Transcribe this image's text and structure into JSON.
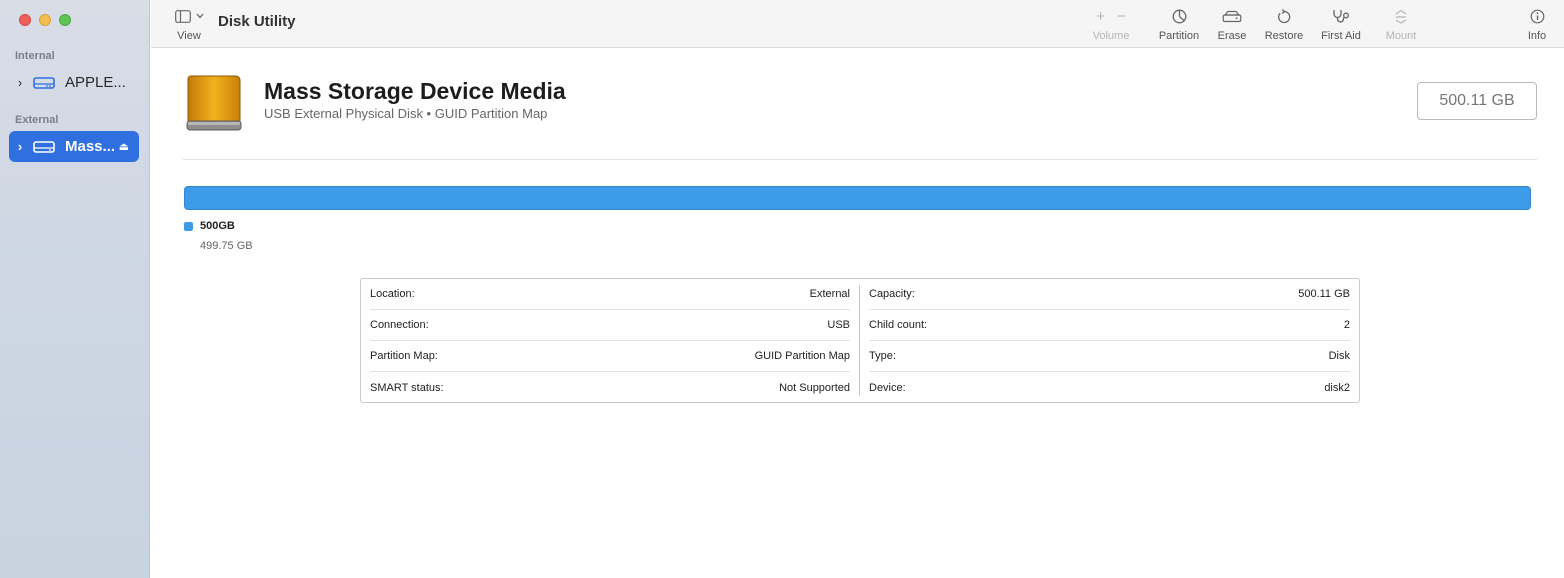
{
  "window": {
    "title": "Disk Utility"
  },
  "sidebar": {
    "sections": [
      {
        "label": "Internal",
        "items": [
          {
            "label": "APPLE...",
            "icon": "internal-drive-icon",
            "selected": false
          }
        ]
      },
      {
        "label": "External",
        "items": [
          {
            "label": "Mass...",
            "icon": "external-drive-icon",
            "selected": true,
            "eject": true
          }
        ]
      }
    ]
  },
  "toolbar": {
    "view_label": "View",
    "volume_label": "Volume",
    "volume_add": "+",
    "volume_remove": "−",
    "partition_label": "Partition",
    "erase_label": "Erase",
    "restore_label": "Restore",
    "first_aid_label": "First Aid",
    "mount_label": "Mount",
    "info_label": "Info"
  },
  "disk": {
    "name": "Mass Storage Device Media",
    "subtitle": "USB External Physical Disk • GUID Partition Map",
    "capacity": "500.11 GB",
    "partition": {
      "name": "500GB",
      "size": "499.75 GB",
      "color": "#3d9be9",
      "fraction": 1.0
    }
  },
  "info": {
    "left": [
      {
        "label": "Location:",
        "value": "External"
      },
      {
        "label": "Connection:",
        "value": "USB"
      },
      {
        "label": "Partition Map:",
        "value": "GUID Partition Map"
      },
      {
        "label": "SMART status:",
        "value": "Not Supported"
      }
    ],
    "right": [
      {
        "label": "Capacity:",
        "value": "500.11 GB"
      },
      {
        "label": "Child count:",
        "value": "2"
      },
      {
        "label": "Type:",
        "value": "Disk"
      },
      {
        "label": "Device:",
        "value": "disk2"
      }
    ]
  }
}
